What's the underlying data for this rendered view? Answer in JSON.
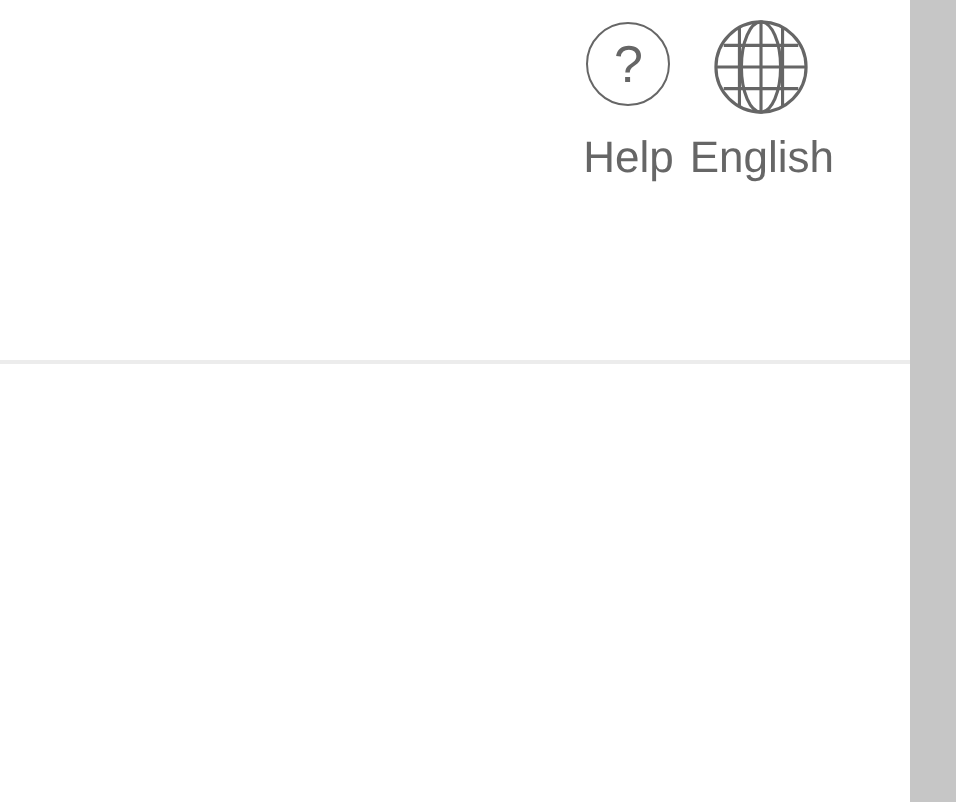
{
  "header": {
    "actions": [
      {
        "kind": "help",
        "icon_text": "?",
        "label": "Help"
      },
      {
        "kind": "language",
        "label": "English"
      }
    ]
  }
}
